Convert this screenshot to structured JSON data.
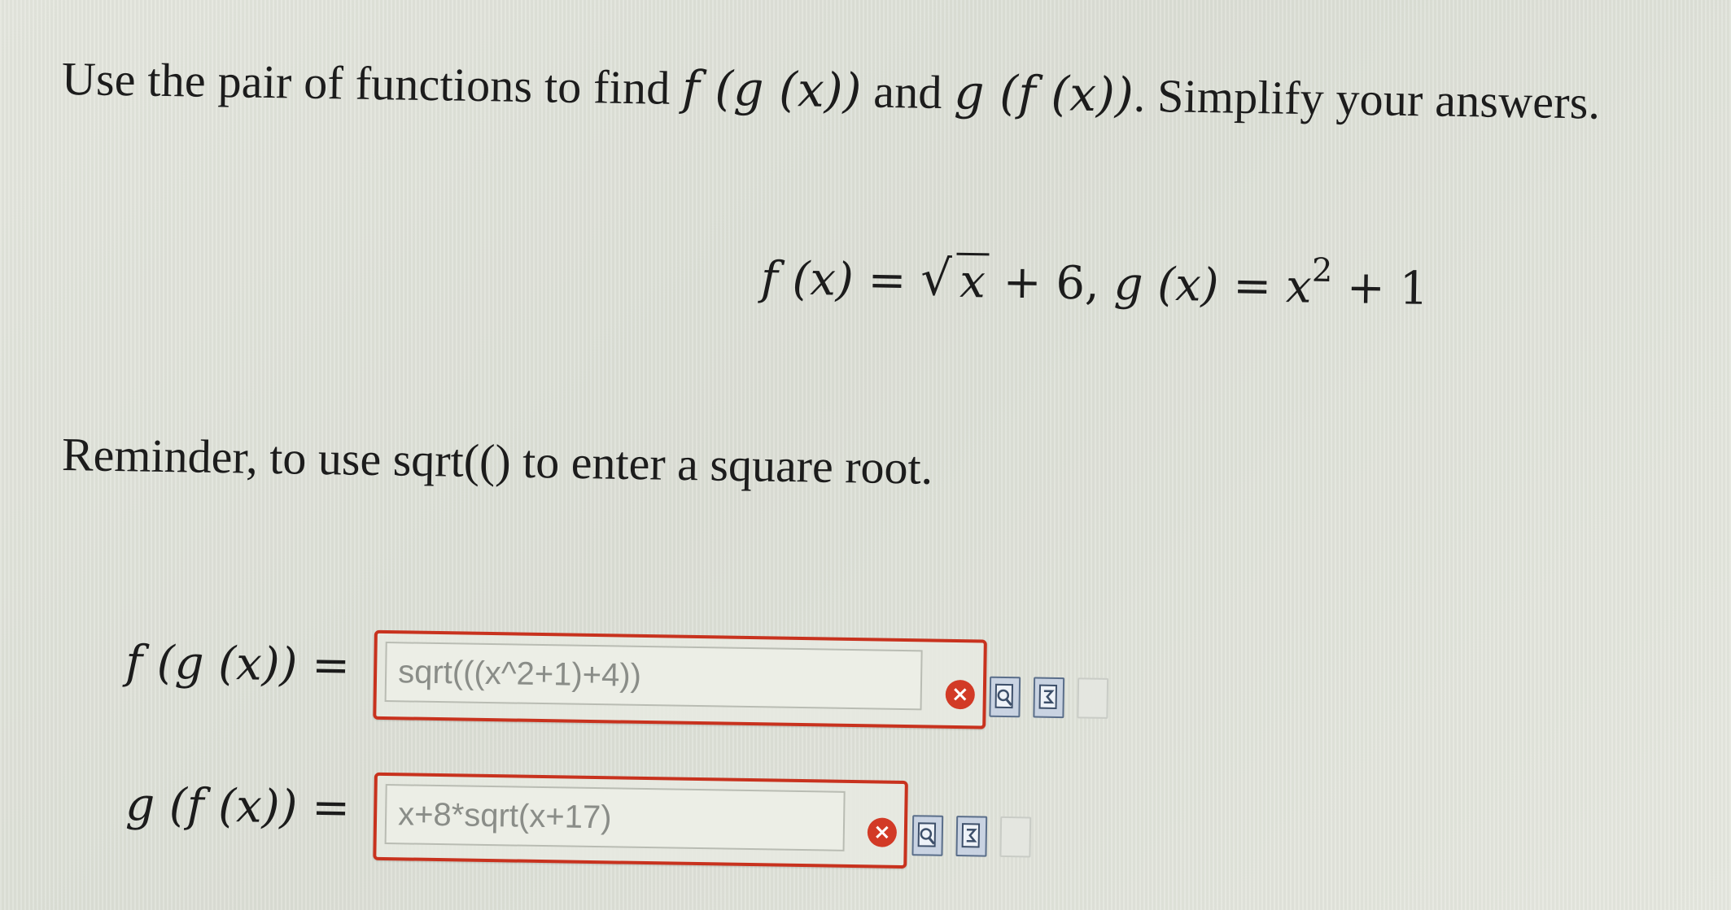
{
  "question": {
    "prefix": "Use the pair of functions to find ",
    "expr1": "f (g (x))",
    "middle": " and ",
    "expr2": "g (f (x))",
    "suffix": ". Simplify your answers."
  },
  "functions": {
    "f_lhs": "f (x) = ",
    "sqrt_symbol": "√",
    "f_radicand": "x",
    "f_rest": " + 6, ",
    "g_lhs": "g (x) = x",
    "g_exponent": "2",
    "g_rest": " + 1"
  },
  "reminder": "Reminder, to use sqrt(() to enter a square root.",
  "answers": [
    {
      "label": "f (g (x)) =",
      "value": "sqrt(((x^2+1)+4))",
      "status": "incorrect"
    },
    {
      "label": "g (f (x)) =",
      "value": "x+8*sqrt(x+17)",
      "status": "incorrect"
    }
  ],
  "icons": {
    "error": "error-x-icon",
    "preview": "preview-icon",
    "equation": "equation-editor-icon",
    "help": "help-icon",
    "error_glyph": "×"
  },
  "colors": {
    "error_border": "#c8321e",
    "error_icon": "#d23a26",
    "tool_icon": "#5a6e8a"
  }
}
